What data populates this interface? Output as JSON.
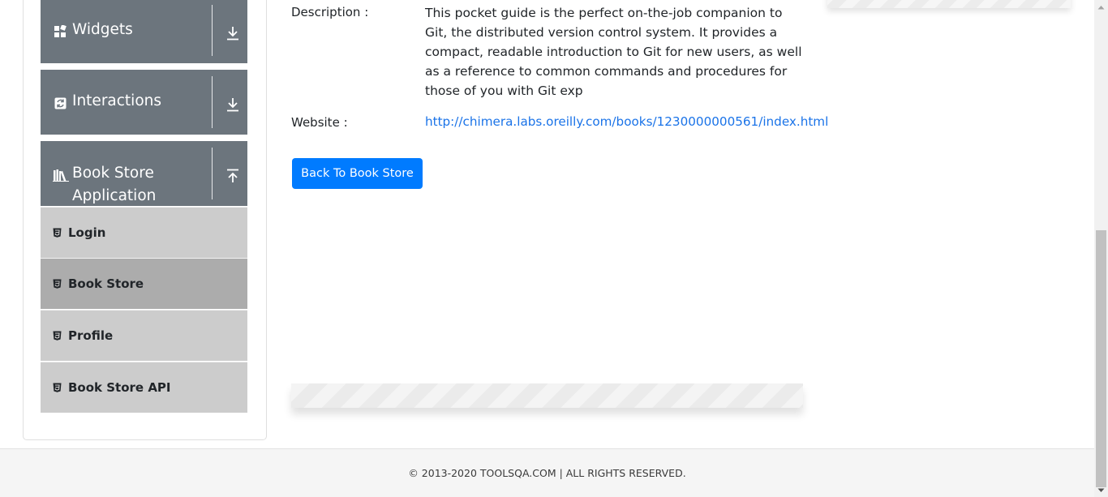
{
  "sidebar": {
    "groups": [
      {
        "label": "Widgets",
        "icon": "widgets-icon"
      },
      {
        "label": "Interactions",
        "icon": "interactions-icon"
      },
      {
        "label_line1": "Book Store",
        "label_line2": "Application",
        "icon": "books-icon"
      }
    ],
    "items": [
      {
        "label": "Login",
        "icon": "html5-icon"
      },
      {
        "label": "Book Store",
        "icon": "html5-icon",
        "active": true
      },
      {
        "label": "Profile",
        "icon": "html5-icon"
      },
      {
        "label": "Book Store API",
        "icon": "html5-icon"
      }
    ]
  },
  "book": {
    "description_label": "Description :",
    "description": "This pocket guide is the perfect on-the-job companion to Git, the distributed version control system. It provides a compact, readable introduction to Git for new users, as well as a reference to common commands and procedures for those of you with Git exp",
    "website_label": "Website :",
    "website": "http://chimera.labs.oreilly.com/books/1230000000561/index.html"
  },
  "actions": {
    "back_label": "Back To Book Store"
  },
  "footer": {
    "text": "© 2013-2020 TOOLSQA.COM | ALL RIGHTS RESERVED."
  },
  "colors": {
    "sidebar_header": "#6c757d",
    "menu_item": "#cccccc",
    "menu_item_active": "#acacac",
    "primary": "#007bff",
    "link": "#1a73e8"
  }
}
